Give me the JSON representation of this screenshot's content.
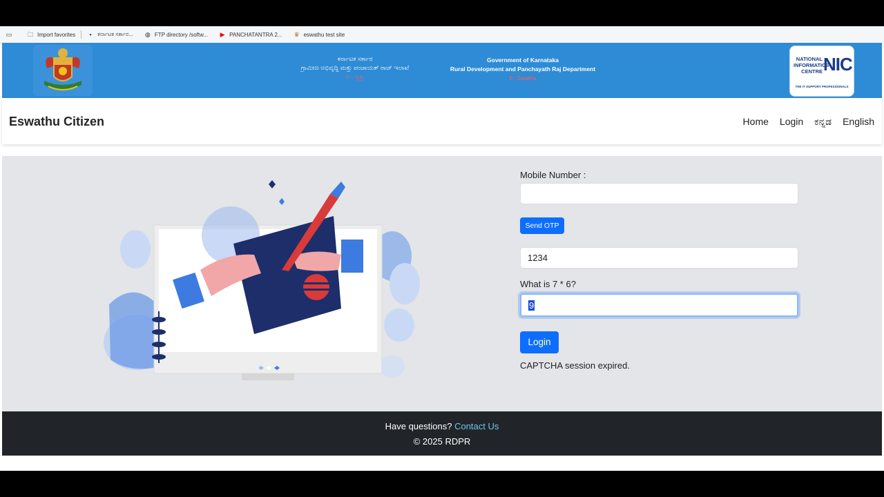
{
  "favorites_bar": {
    "items": [
      {
        "label": "Import favorites",
        "icon": "folder-icon"
      },
      {
        "label": "ಕರ್ನಾಟಕ ಸರ್ಕಾರ...",
        "icon": "page-icon"
      },
      {
        "label": "FTP directory /softw...",
        "icon": "globe-icon"
      },
      {
        "label": "PANCHATANTRA 2...",
        "icon": "youtube-icon"
      },
      {
        "label": "eswathu test site",
        "icon": "emblem-icon"
      }
    ]
  },
  "gov_header": {
    "kn_line1": "ಕರ್ನಾಟಕ ಸರ್ಕಾರ",
    "kn_line2": "ಗ್ರಾಮೀಣ ಅಭಿವೃದ್ಧಿ ಮತ್ತು ಪಂಚಾಯತ್ ರಾಜ್ ಇಲಾಖೆ",
    "kn_line3": "ಇ - ಸ್ವತ್ತು",
    "en_line1": "Government of Karnataka",
    "en_line2": "Rural Development and Panchayath Raj Department",
    "en_line3": "E- Swathu",
    "nic_line1": "NATIONAL",
    "nic_line2": "INFORMATICS",
    "nic_line3": "CENTRE",
    "nic_abbr": "NIC",
    "nic_tagline": "THE IT SUPPORT PROFESSIONALS"
  },
  "navbar": {
    "brand": "Eswathu Citizen",
    "links": [
      "Home",
      "Login",
      "ಕನ್ನಡ",
      "English"
    ]
  },
  "form": {
    "mobile_label": "Mobile Number :",
    "mobile_value": "",
    "send_otp": "Send OTP",
    "otp_value": "1234",
    "captcha_question": "What is 7 * 6?",
    "captcha_value": "9",
    "login": "Login",
    "message": "CAPTCHA session expired."
  },
  "footer": {
    "question": "Have questions?",
    "contact": "Contact Us",
    "copyright": "© 2025 RDPR"
  },
  "colors": {
    "header_blue": "#2e8bd6",
    "primary_button": "#0d6efd",
    "footer_bg": "#212529",
    "main_bg": "#e3e5e8",
    "contact_link": "#6ec6e8"
  }
}
